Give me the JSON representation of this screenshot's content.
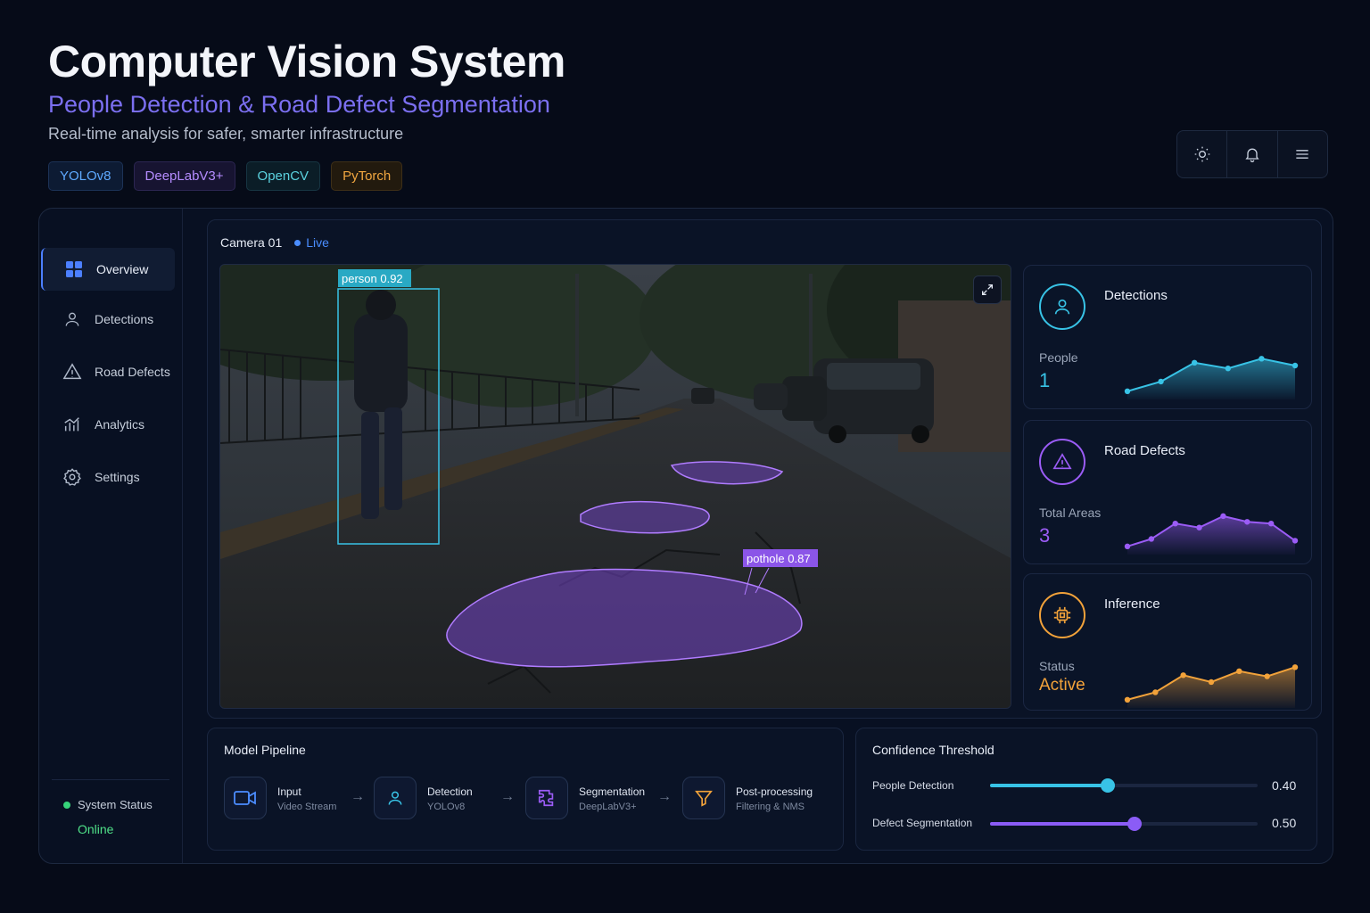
{
  "header": {
    "title": "Computer Vision System",
    "subtitle": "People Detection & Road Defect Segmentation",
    "tagline": "Real-time analysis for safer, smarter infrastructure",
    "tags": [
      "YOLOv8",
      "DeepLabV3+",
      "OpenCV",
      "PyTorch"
    ]
  },
  "toolbar": {
    "icons": [
      "sun-icon",
      "bell-icon",
      "menu-icon"
    ]
  },
  "sidebar": {
    "items": [
      {
        "label": "Overview",
        "icon": "grid-icon",
        "active": true
      },
      {
        "label": "Detections",
        "icon": "person-icon",
        "active": false
      },
      {
        "label": "Road Defects",
        "icon": "warning-icon",
        "active": false
      },
      {
        "label": "Analytics",
        "icon": "bar-chart-icon",
        "active": false
      },
      {
        "label": "Settings",
        "icon": "gear-icon",
        "active": false
      }
    ],
    "status_label": "System Status",
    "status_value": "Online"
  },
  "camera": {
    "name": "Camera 01",
    "live_label": "Live",
    "person_label": "person 0.92",
    "pothole_label": "pothole 0.87"
  },
  "stats": [
    {
      "title": "Detections",
      "label": "People",
      "value": "1",
      "color": "#38c3e6",
      "trend": [
        0.05,
        0.22,
        0.55,
        0.45,
        0.62,
        0.5
      ]
    },
    {
      "title": "Road Defects",
      "label": "Total Areas",
      "value": "3",
      "color": "#9b5cf6",
      "trend": [
        0.05,
        0.18,
        0.45,
        0.38,
        0.58,
        0.48,
        0.45,
        0.15
      ]
    },
    {
      "title": "Inference",
      "label": "Status",
      "value": "Active",
      "color": "#f2a23a",
      "trend": [
        0.05,
        0.18,
        0.48,
        0.36,
        0.55,
        0.46,
        0.62
      ]
    }
  ],
  "pipeline": {
    "title": "Model Pipeline",
    "steps": [
      {
        "name": "Input",
        "sub": "Video Stream",
        "icon": "video-camera-icon"
      },
      {
        "name": "Detection",
        "sub": "YOLOv8",
        "icon": "person-icon"
      },
      {
        "name": "Segmentation",
        "sub": "DeepLabV3+",
        "icon": "puzzle-icon"
      },
      {
        "name": "Post-processing",
        "sub": "Filtering & NMS",
        "icon": "filter-icon"
      }
    ]
  },
  "confidence": {
    "title": "Confidence Threshold",
    "sliders": [
      {
        "label": "People Detection",
        "value": "0.40",
        "level": 0.44,
        "color": "#38c3e6"
      },
      {
        "label": "Defect Segmentation",
        "value": "0.50",
        "level": 0.54,
        "color": "#8b5cf6"
      }
    ]
  }
}
